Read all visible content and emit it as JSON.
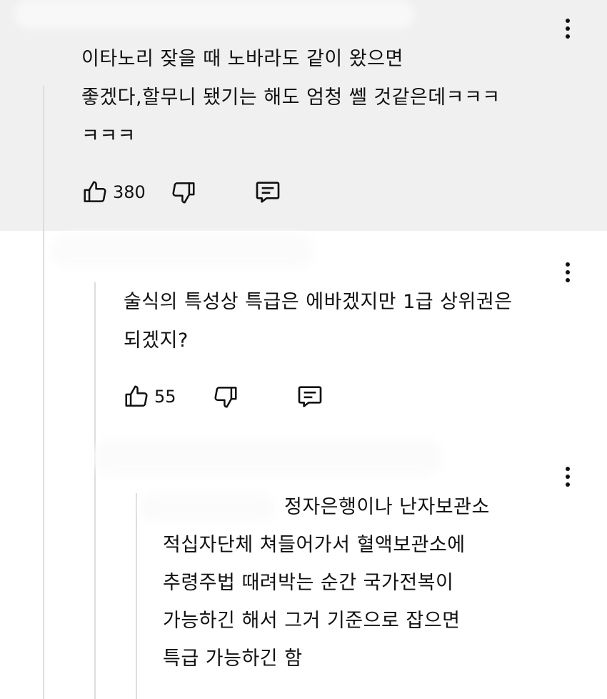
{
  "comments": [
    {
      "lines": [
        "이타노리 잦을 때 노바라도 같이 왔으면",
        "좋겠다,할무니 됐기는 해도 엄청 쎌 것같은데ㅋㅋㅋ",
        "ㅋㅋㅋ"
      ],
      "likes": "380"
    },
    {
      "lines": [
        "술식의 특성상 특급은 에바겠지만 1급 상위권은",
        "되겠지?"
      ],
      "likes": "55"
    },
    {
      "lines": [
        "정자은행이나 난자보관소",
        "적십자단체 쳐들어가서 혈액보관소에",
        "추령주법 때려박는 순간 국가전복이",
        "가능하긴 해서 그거 기준으로 잡으면",
        "특급 가능하긴 함"
      ]
    }
  ],
  "icons": {
    "more": "more-vert-icon",
    "like": "thumb-up-icon",
    "dislike": "thumb-down-icon",
    "reply": "reply-comment-icon"
  },
  "colors": {
    "top_bg": "#f0f0f0",
    "text": "#111111"
  }
}
